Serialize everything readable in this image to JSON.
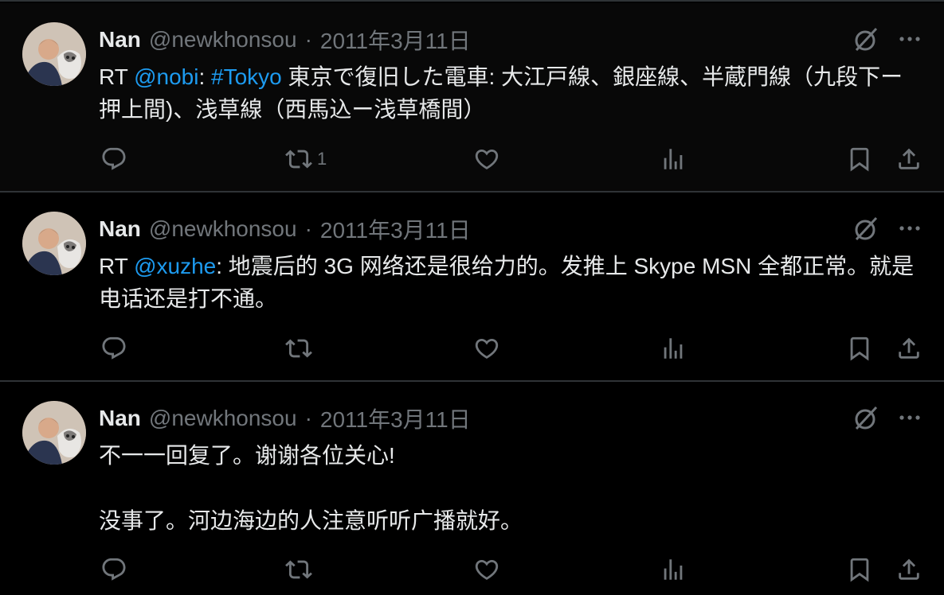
{
  "tweets": [
    {
      "display_name": "Nan",
      "handle": "@newkhonsou",
      "separator": "·",
      "date": "2011年3月11日",
      "text_parts": [
        {
          "text": "RT ",
          "link": false
        },
        {
          "text": "@nobi",
          "link": true
        },
        {
          "text": ": ",
          "link": false
        },
        {
          "text": "#Tokyo",
          "link": true
        },
        {
          "text": " 東京で復旧した電車: 大江戸線、銀座線、半蔵門線（九段下ー押上間)、浅草線（西馬込ー浅草橋間）",
          "link": false
        }
      ],
      "retweet_count": "1",
      "icons": [
        "reply-icon",
        "retweet-icon",
        "like-icon",
        "views-icon",
        "bookmark-icon",
        "share-icon"
      ]
    },
    {
      "display_name": "Nan",
      "handle": "@newkhonsou",
      "separator": "·",
      "date": "2011年3月11日",
      "text_parts": [
        {
          "text": "RT ",
          "link": false
        },
        {
          "text": "@xuzhe",
          "link": true
        },
        {
          "text": ": 地震后的 3G 网络还是很给力的。发推上 Skype MSN 全都正常。就是电话还是打不通。",
          "link": false
        }
      ],
      "retweet_count": "",
      "icons": [
        "reply-icon",
        "retweet-icon",
        "like-icon",
        "views-icon",
        "bookmark-icon",
        "share-icon"
      ]
    },
    {
      "display_name": "Nan",
      "handle": "@newkhonsou",
      "separator": "·",
      "date": "2011年3月11日",
      "text_parts": [
        {
          "text": "不一一回复了。谢谢各位关心!\n\n没事了。河边海边的人注意听听广播就好。",
          "link": false
        }
      ],
      "retweet_count": "",
      "icons": [
        "reply-icon",
        "retweet-icon",
        "like-icon",
        "views-icon",
        "bookmark-icon",
        "share-icon"
      ]
    }
  ],
  "colors": {
    "background": "#000000",
    "text": "#e7e9ea",
    "muted": "#71767b",
    "link": "#1d9bf0",
    "divider": "#2f3336"
  }
}
